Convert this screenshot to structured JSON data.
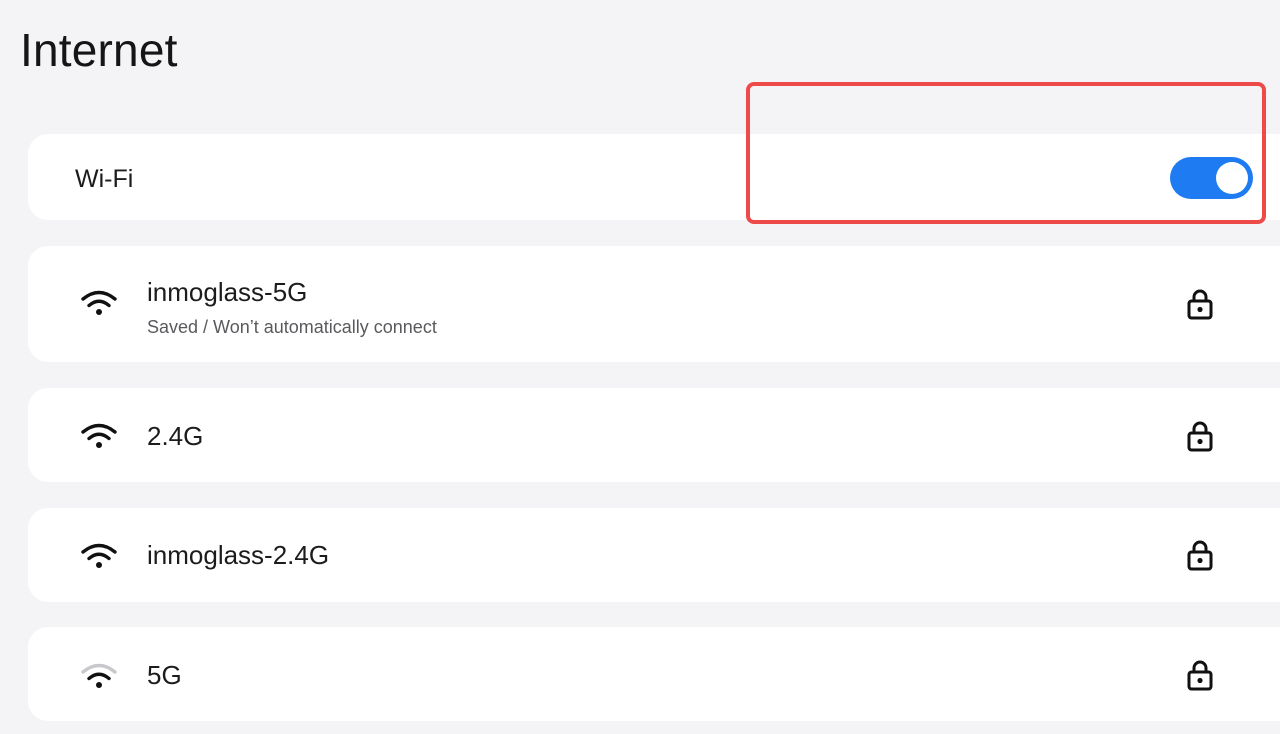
{
  "page": {
    "title": "Internet"
  },
  "wifi": {
    "label": "Wi-Fi",
    "enabled": true,
    "toggle_color": "#1e7bf2"
  },
  "highlight_color": "#ef4a4a",
  "networks": [
    {
      "ssid": "inmoglass-5G",
      "status": "Saved / Won’t automatically connect",
      "signal_icon": "wifi-full-icon",
      "secured": true
    },
    {
      "ssid": "2.4G",
      "status": "",
      "signal_icon": "wifi-full-icon",
      "secured": true
    },
    {
      "ssid": "inmoglass-2.4G",
      "status": "",
      "signal_icon": "wifi-full-icon",
      "secured": true
    },
    {
      "ssid": "5G",
      "status": "",
      "signal_icon": "wifi-weak-icon",
      "secured": true
    }
  ]
}
